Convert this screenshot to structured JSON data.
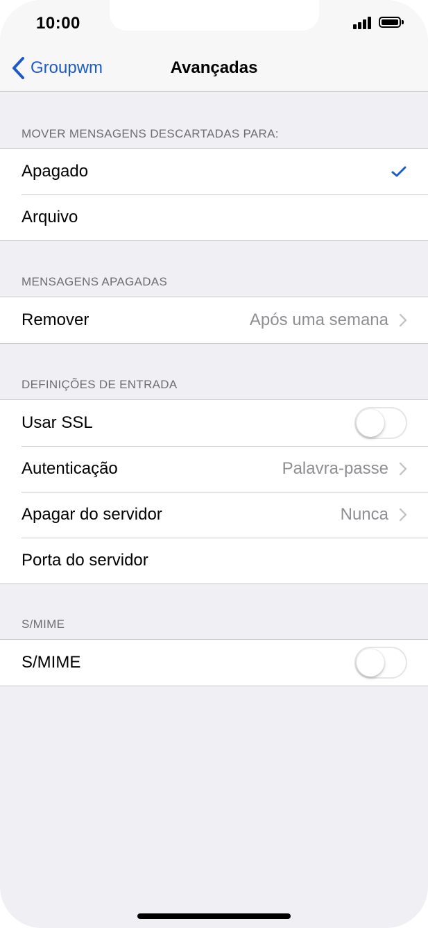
{
  "status_bar": {
    "time": "10:00",
    "icons": [
      "signal-icon",
      "battery-icon"
    ]
  },
  "nav": {
    "back_label": "Groupwm",
    "back_icon": "chevron-left-icon",
    "title": "Avançadas"
  },
  "sections": {
    "discarded": {
      "header": "MOVER MENSAGENS DESCARTADAS PARA:",
      "options": [
        {
          "label": "Apagado",
          "selected": true
        },
        {
          "label": "Arquivo",
          "selected": false
        }
      ]
    },
    "deleted": {
      "header": "MENSAGENS APAGADAS",
      "remove_label": "Remover",
      "remove_value": "Após uma semana"
    },
    "incoming": {
      "header": "DEFINIÇÕES DE ENTRADA",
      "ssl_label": "Usar SSL",
      "ssl_on": false,
      "auth_label": "Autenticação",
      "auth_value": "Palavra-passe",
      "delete_server_label": "Apagar do servidor",
      "delete_server_value": "Nunca",
      "port_label": "Porta do servidor",
      "port_value": ""
    },
    "smime": {
      "header": "S/MIME",
      "label": "S/MIME",
      "on": false
    }
  },
  "colors": {
    "accent": "#1e5bc6",
    "background": "#efeff4",
    "secondary_text": "#8e8e93",
    "separator": "#c8c7cc"
  }
}
